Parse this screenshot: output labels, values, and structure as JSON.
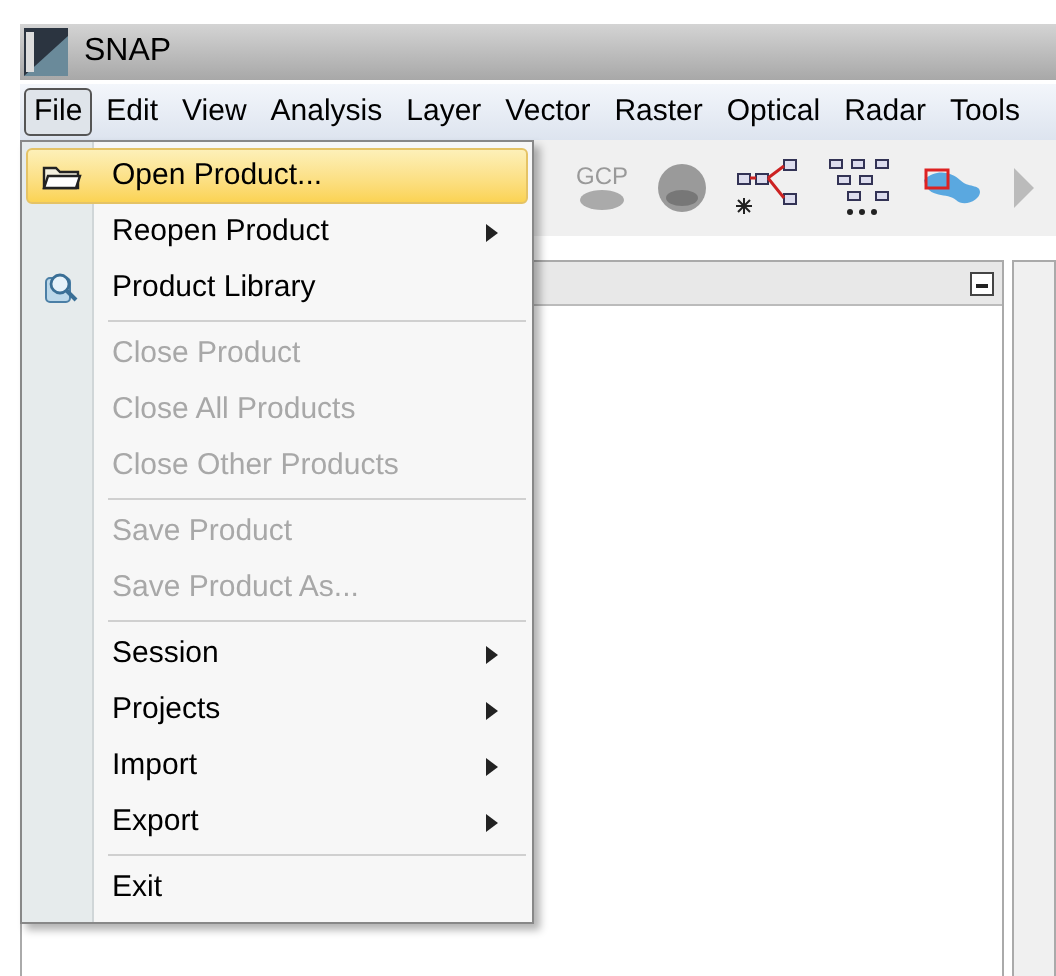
{
  "window": {
    "title": "SNAP"
  },
  "menubar": [
    {
      "label": "File",
      "selected": true
    },
    {
      "label": "Edit",
      "selected": false
    },
    {
      "label": "View",
      "selected": false
    },
    {
      "label": "Analysis",
      "selected": false
    },
    {
      "label": "Layer",
      "selected": false
    },
    {
      "label": "Vector",
      "selected": false
    },
    {
      "label": "Raster",
      "selected": false
    },
    {
      "label": "Optical",
      "selected": false
    },
    {
      "label": "Radar",
      "selected": false
    },
    {
      "label": "Tools",
      "selected": false
    }
  ],
  "toolbar": {
    "gcp_label": "GCP"
  },
  "file_menu": [
    {
      "kind": "item",
      "label": "Open Product...",
      "selected": true,
      "disabled": false,
      "submenu": false
    },
    {
      "kind": "item",
      "label": "Reopen Product",
      "selected": false,
      "disabled": false,
      "submenu": true
    },
    {
      "kind": "item",
      "label": "Product Library",
      "selected": false,
      "disabled": false,
      "submenu": false
    },
    {
      "kind": "separator"
    },
    {
      "kind": "item",
      "label": "Close Product",
      "selected": false,
      "disabled": true,
      "submenu": false
    },
    {
      "kind": "item",
      "label": "Close All Products",
      "selected": false,
      "disabled": true,
      "submenu": false
    },
    {
      "kind": "item",
      "label": "Close Other Products",
      "selected": false,
      "disabled": true,
      "submenu": false
    },
    {
      "kind": "separator"
    },
    {
      "kind": "item",
      "label": "Save Product",
      "selected": false,
      "disabled": true,
      "submenu": false
    },
    {
      "kind": "item",
      "label": "Save Product As...",
      "selected": false,
      "disabled": true,
      "submenu": false
    },
    {
      "kind": "separator"
    },
    {
      "kind": "item",
      "label": "Session",
      "selected": false,
      "disabled": false,
      "submenu": true
    },
    {
      "kind": "item",
      "label": "Projects",
      "selected": false,
      "disabled": false,
      "submenu": true
    },
    {
      "kind": "item",
      "label": "Import",
      "selected": false,
      "disabled": false,
      "submenu": true
    },
    {
      "kind": "item",
      "label": "Export",
      "selected": false,
      "disabled": false,
      "submenu": true
    },
    {
      "kind": "separator"
    },
    {
      "kind": "item",
      "label": "Exit",
      "selected": false,
      "disabled": false,
      "submenu": false
    }
  ]
}
